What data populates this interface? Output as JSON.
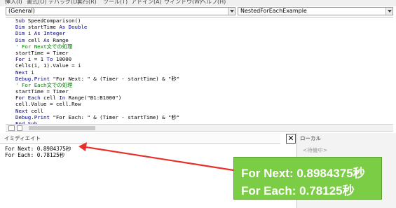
{
  "menubar": {
    "items": [
      "挿入(I)",
      "書式(O)",
      "デバッグ(D)",
      "実行(R)",
      "ツール(T)",
      "アドイン(A)",
      "ウィンドウ(W)",
      "ヘルプ(H)"
    ]
  },
  "object_combo": {
    "value": "(General)"
  },
  "procedure_combo": {
    "value": "NestedForEachExample"
  },
  "code_lines": [
    [
      {
        "t": "kw",
        "v": "Sub "
      },
      {
        "t": "tx",
        "v": "SpeedComparison()"
      }
    ],
    [
      {
        "t": "kw",
        "v": "Dim "
      },
      {
        "t": "tx",
        "v": "startTime "
      },
      {
        "t": "kw",
        "v": "As Double"
      }
    ],
    [
      {
        "t": "kw",
        "v": "Dim "
      },
      {
        "t": "tx",
        "v": "i "
      },
      {
        "t": "kw",
        "v": "As Integer"
      }
    ],
    [
      {
        "t": "kw",
        "v": "Dim "
      },
      {
        "t": "tx",
        "v": "cell "
      },
      {
        "t": "kw",
        "v": "As "
      },
      {
        "t": "tx",
        "v": "Range"
      }
    ],
    [
      {
        "t": "cm",
        "v": "' For Next文での処理"
      }
    ],
    [
      {
        "t": "tx",
        "v": "startTime = Timer"
      }
    ],
    [
      {
        "t": "kw",
        "v": "For "
      },
      {
        "t": "tx",
        "v": "i = 1 "
      },
      {
        "t": "kw",
        "v": "To "
      },
      {
        "t": "tx",
        "v": "10000"
      }
    ],
    [
      {
        "t": "tx",
        "v": "Cells(i, 1).Value = i"
      }
    ],
    [
      {
        "t": "kw",
        "v": "Next "
      },
      {
        "t": "tx",
        "v": "i"
      }
    ],
    [
      {
        "t": "kw",
        "v": "Debug.Print "
      },
      {
        "t": "tx",
        "v": "\"For Next: \" & (Timer - startTime) & \"秒\""
      }
    ],
    [
      {
        "t": "cm",
        "v": "' For Each文での処理"
      }
    ],
    [
      {
        "t": "tx",
        "v": "startTime = Timer"
      }
    ],
    [
      {
        "t": "kw",
        "v": "For Each "
      },
      {
        "t": "tx",
        "v": "cell "
      },
      {
        "t": "kw",
        "v": "In "
      },
      {
        "t": "tx",
        "v": "Range(\"B1:B1000\")"
      }
    ],
    [
      {
        "t": "tx",
        "v": "cell.Value = cell.Row"
      }
    ],
    [
      {
        "t": "kw",
        "v": "Next "
      },
      {
        "t": "tx",
        "v": "cell"
      }
    ],
    [
      {
        "t": "kw",
        "v": "Debug.Print "
      },
      {
        "t": "tx",
        "v": "\"For Each: \" & (Timer - startTime) & \"秒\""
      }
    ],
    [
      {
        "t": "kw",
        "v": "End Sub"
      }
    ]
  ],
  "immediate": {
    "title": "イミディエイト",
    "lines": [
      "For Next: 0.8984375秒",
      "For Each: 0.78125秒"
    ]
  },
  "locals": {
    "title": "ローカル",
    "status": "<待機中>"
  },
  "callout": {
    "line1": "For Next: 0.8984375秒",
    "line2": "For Each: 0.78125秒",
    "color": "#7ccd46"
  },
  "arrow_color": "#e8302a"
}
